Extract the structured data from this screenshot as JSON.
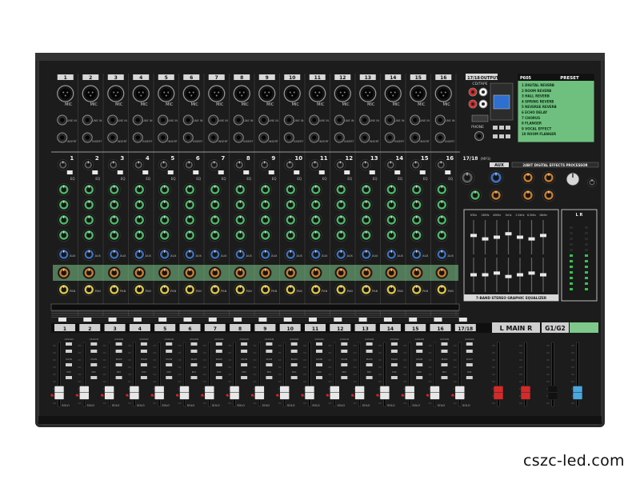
{
  "channels": [
    "1",
    "2",
    "3",
    "4",
    "5",
    "6",
    "7",
    "8",
    "9",
    "10",
    "11",
    "12",
    "13",
    "14",
    "15",
    "16"
  ],
  "stereo_input_label": "17/18",
  "input_labels": {
    "mic": "MIC",
    "line_in": "LINE IN",
    "insert": "INSERT",
    "eq": "EQ",
    "aux": "AUX",
    "pan": "PAN",
    "pad": "PAD",
    "solo": "SOLO",
    "main": "MAIN",
    "mix": "MIX",
    "assign": "ASSIGN"
  },
  "master_section": {
    "output_label": "OUTPUT",
    "cd_tape_label": "CD/TAPE",
    "phone_label": "PHONE",
    "preset_header": "PRESET",
    "preset_code": "P605",
    "preset_list": [
      "1 DIGITAL REVERB",
      "2 ROOM REVERB",
      "3 HALL REVERB",
      "4 SPRING REVERB",
      "5 REVERSE REVERB",
      "6 ECHO DELAY",
      "7 CHORUS",
      "8 FLANGER",
      "9 VOCAL EFFECT",
      "10 ROOM FLANGER"
    ],
    "effects_processor_title": "24BIT DIGITAL EFFECTS PROCESSOR",
    "aux_label": "AUX",
    "ch_17_18_label": "17/18",
    "ch_17_18_sub": "(MP3)",
    "eq_title": "7-BAND STEREO GRAPHIC EQUALIZER",
    "eq_bands": [
      "63Hz",
      "160Hz",
      "400Hz",
      "1kHz",
      "2.5kHz",
      "6.3kHz",
      "16kHz"
    ],
    "eq_levels_top": [
      0.55,
      0.45,
      0.5,
      0.6,
      0.5,
      0.45,
      0.55
    ],
    "eq_levels_bottom": [
      0.5,
      0.5,
      0.55,
      0.45,
      0.5,
      0.55,
      0.5
    ],
    "meter_lr": "L   R",
    "meter_level": 0.55
  },
  "fader_section": {
    "strip_labels": [
      "1",
      "2",
      "3",
      "4",
      "5",
      "6",
      "7",
      "8",
      "9",
      "10",
      "11",
      "12",
      "13",
      "14",
      "15",
      "16",
      "17/18"
    ],
    "main_label": "L  MAIN  R",
    "group_label": "G1/G2",
    "fader_levels": [
      0.22,
      0.22,
      0.22,
      0.22,
      0.22,
      0.22,
      0.22,
      0.22,
      0.22,
      0.22,
      0.22,
      0.22,
      0.22,
      0.22,
      0.22,
      0.22,
      0.22,
      0.22,
      0.22,
      0.22,
      0.22
    ],
    "fader_cap_colors": [
      "#e8e8e8",
      "#e8e8e8",
      "#e8e8e8",
      "#e8e8e8",
      "#e8e8e8",
      "#e8e8e8",
      "#e8e8e8",
      "#e8e8e8",
      "#e8e8e8",
      "#e8e8e8",
      "#e8e8e8",
      "#e8e8e8",
      "#e8e8e8",
      "#e8e8e8",
      "#e8e8e8",
      "#e8e8e8",
      "#e8e8e8",
      "#d42a2a",
      "#d42a2a",
      "#111111",
      "#4aa8e0"
    ]
  },
  "colors": {
    "body": "#1b1c1b",
    "panel_line": "#9a9a9a",
    "green_strip": "#7ec88c",
    "green_knob": "#4fb468",
    "blue_knob": "#3e6fb8",
    "orange_knob": "#c87c2c",
    "yellow_knob": "#d9c24a",
    "red_led": "#e02020"
  },
  "watermark": "cszc-led.com"
}
